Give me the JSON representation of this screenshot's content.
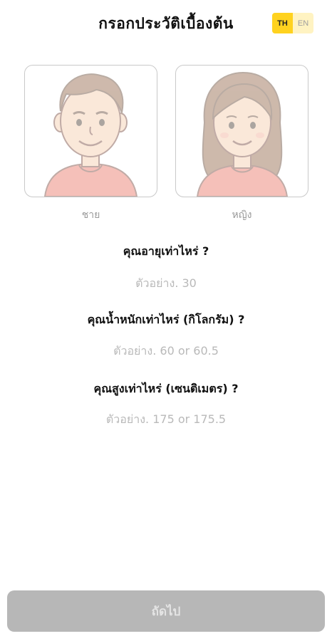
{
  "header": {
    "title": "กรอกประวัติเบื้องต้น",
    "lang": {
      "th_label": "TH",
      "en_label": "EN",
      "selected": "TH"
    }
  },
  "gender": {
    "male_label": "ชาย",
    "female_label": "หญิง",
    "male_icon": "male-avatar-icon",
    "female_icon": "female-avatar-icon"
  },
  "questions": {
    "age": {
      "label": "คุณอายุเท่าไหร่ ?",
      "value": "",
      "placeholder": "ตัวอย่าง. 30"
    },
    "weight": {
      "label": "คุณน้ำหนักเท่าไหร่ (กิโลกรัม) ?",
      "value": "",
      "placeholder": "ตัวอย่าง. 60 or 60.5"
    },
    "height": {
      "label": "คุณสูงเท่าไหร่ (เซนติเมตร) ?",
      "value": "",
      "placeholder": "ตัวอย่าง. 175 or 175.5"
    }
  },
  "footer": {
    "next_label": "ถัดไป"
  },
  "colors": {
    "accent": "#FFD21F",
    "accent_light": "#FFF3C2",
    "disabled_button": "#B7B7B7",
    "shirt": "#E86A5A",
    "skin": "#F5C9A6"
  }
}
